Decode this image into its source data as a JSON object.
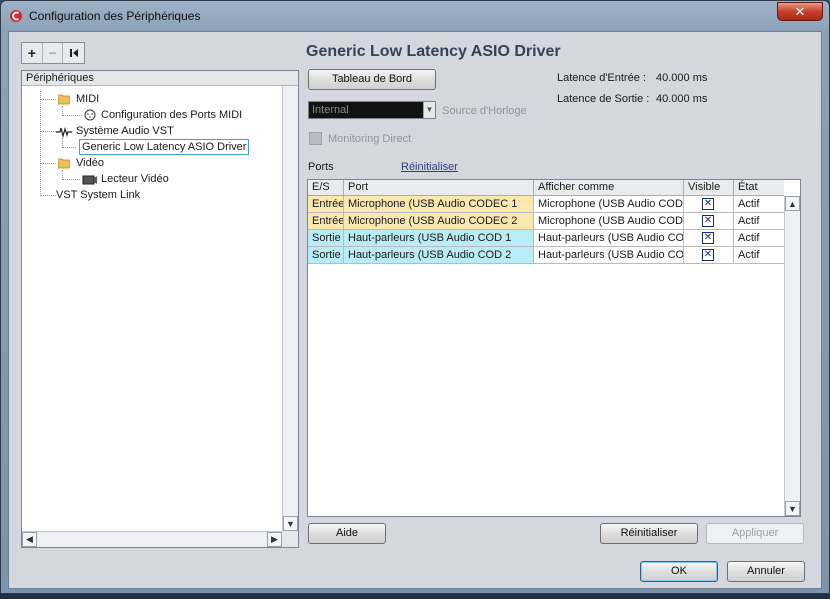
{
  "window": {
    "title": "Configuration des Périphériques",
    "close_label": "✕"
  },
  "toolbar": {
    "add_label": "+",
    "remove_label": "−",
    "reset_label": "⏮"
  },
  "tree": {
    "header": "Périphériques",
    "items": [
      {
        "label": "MIDI",
        "icon": "folder-icon",
        "level": 1
      },
      {
        "label": "Configuration des Ports MIDI",
        "icon": "midi-port-icon",
        "level": 2
      },
      {
        "label": "Système Audio VST",
        "icon": "audio-system-icon",
        "level": 1
      },
      {
        "label": "Generic Low Latency ASIO Driver",
        "icon": "",
        "level": 2,
        "selected": true
      },
      {
        "label": "Vidéo",
        "icon": "folder-icon",
        "level": 1
      },
      {
        "label": "Lecteur Vidéo",
        "icon": "video-player-icon",
        "level": 2
      },
      {
        "label": "VST System Link",
        "icon": "",
        "level": 1
      }
    ]
  },
  "driver": {
    "title": "Generic Low Latency ASIO Driver",
    "control_panel_label": "Tableau de Bord",
    "input_latency_label": "Latence d'Entrée :",
    "input_latency_value": "40.000 ms",
    "output_latency_label": "Latence de Sortie :",
    "output_latency_value": "40.000 ms",
    "clock_source_value": "Internal",
    "clock_source_label": "Source d'Horloge",
    "monitoring_label": "Monitoring Direct"
  },
  "ports": {
    "label": "Ports",
    "reset_link": "Réinitialiser",
    "columns": [
      "E/S",
      "Port",
      "Afficher comme",
      "Visible",
      "État"
    ],
    "rows": [
      {
        "io": "Entrée",
        "port": "Microphone (USB Audio CODEC  1",
        "display": "Microphone (USB Audio CODEC",
        "visible": true,
        "state": "Actif",
        "kind": "in"
      },
      {
        "io": "Entrée",
        "port": "Microphone (USB Audio CODEC  2",
        "display": "Microphone (USB Audio CODEC",
        "visible": true,
        "state": "Actif",
        "kind": "in"
      },
      {
        "io": "Sortie",
        "port": "Haut-parleurs (USB Audio COD 1",
        "display": "Haut-parleurs (USB Audio COD",
        "visible": true,
        "state": "Actif",
        "kind": "out"
      },
      {
        "io": "Sortie",
        "port": "Haut-parleurs (USB Audio COD 2",
        "display": "Haut-parleurs (USB Audio COD",
        "visible": true,
        "state": "Actif",
        "kind": "out"
      }
    ]
  },
  "buttons": {
    "help": "Aide",
    "reset": "Réinitialiser",
    "apply": "Appliquer",
    "ok": "OK",
    "cancel": "Annuler"
  },
  "colors": {
    "input_row": "#fbe8b0",
    "output_row": "#b9ecf6",
    "selection_outline": "#3fa7c6",
    "title_text": "#334455"
  }
}
